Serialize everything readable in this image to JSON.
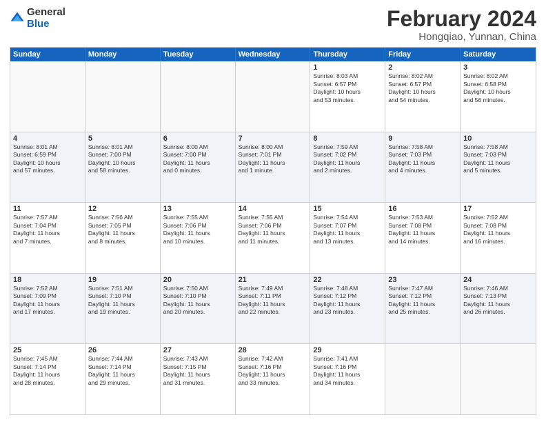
{
  "logo": {
    "general": "General",
    "blue": "Blue"
  },
  "title": "February 2024",
  "subtitle": "Hongqiao, Yunnan, China",
  "headers": [
    "Sunday",
    "Monday",
    "Tuesday",
    "Wednesday",
    "Thursday",
    "Friday",
    "Saturday"
  ],
  "weeks": [
    [
      {
        "day": "",
        "info": ""
      },
      {
        "day": "",
        "info": ""
      },
      {
        "day": "",
        "info": ""
      },
      {
        "day": "",
        "info": ""
      },
      {
        "day": "1",
        "info": "Sunrise: 8:03 AM\nSunset: 6:57 PM\nDaylight: 10 hours\nand 53 minutes."
      },
      {
        "day": "2",
        "info": "Sunrise: 8:02 AM\nSunset: 6:57 PM\nDaylight: 10 hours\nand 54 minutes."
      },
      {
        "day": "3",
        "info": "Sunrise: 8:02 AM\nSunset: 6:58 PM\nDaylight: 10 hours\nand 56 minutes."
      }
    ],
    [
      {
        "day": "4",
        "info": "Sunrise: 8:01 AM\nSunset: 6:59 PM\nDaylight: 10 hours\nand 57 minutes."
      },
      {
        "day": "5",
        "info": "Sunrise: 8:01 AM\nSunset: 7:00 PM\nDaylight: 10 hours\nand 58 minutes."
      },
      {
        "day": "6",
        "info": "Sunrise: 8:00 AM\nSunset: 7:00 PM\nDaylight: 11 hours\nand 0 minutes."
      },
      {
        "day": "7",
        "info": "Sunrise: 8:00 AM\nSunset: 7:01 PM\nDaylight: 11 hours\nand 1 minute."
      },
      {
        "day": "8",
        "info": "Sunrise: 7:59 AM\nSunset: 7:02 PM\nDaylight: 11 hours\nand 2 minutes."
      },
      {
        "day": "9",
        "info": "Sunrise: 7:58 AM\nSunset: 7:03 PM\nDaylight: 11 hours\nand 4 minutes."
      },
      {
        "day": "10",
        "info": "Sunrise: 7:58 AM\nSunset: 7:03 PM\nDaylight: 11 hours\nand 5 minutes."
      }
    ],
    [
      {
        "day": "11",
        "info": "Sunrise: 7:57 AM\nSunset: 7:04 PM\nDaylight: 11 hours\nand 7 minutes."
      },
      {
        "day": "12",
        "info": "Sunrise: 7:56 AM\nSunset: 7:05 PM\nDaylight: 11 hours\nand 8 minutes."
      },
      {
        "day": "13",
        "info": "Sunrise: 7:55 AM\nSunset: 7:06 PM\nDaylight: 11 hours\nand 10 minutes."
      },
      {
        "day": "14",
        "info": "Sunrise: 7:55 AM\nSunset: 7:06 PM\nDaylight: 11 hours\nand 11 minutes."
      },
      {
        "day": "15",
        "info": "Sunrise: 7:54 AM\nSunset: 7:07 PM\nDaylight: 11 hours\nand 13 minutes."
      },
      {
        "day": "16",
        "info": "Sunrise: 7:53 AM\nSunset: 7:08 PM\nDaylight: 11 hours\nand 14 minutes."
      },
      {
        "day": "17",
        "info": "Sunrise: 7:52 AM\nSunset: 7:08 PM\nDaylight: 11 hours\nand 16 minutes."
      }
    ],
    [
      {
        "day": "18",
        "info": "Sunrise: 7:52 AM\nSunset: 7:09 PM\nDaylight: 11 hours\nand 17 minutes."
      },
      {
        "day": "19",
        "info": "Sunrise: 7:51 AM\nSunset: 7:10 PM\nDaylight: 11 hours\nand 19 minutes."
      },
      {
        "day": "20",
        "info": "Sunrise: 7:50 AM\nSunset: 7:10 PM\nDaylight: 11 hours\nand 20 minutes."
      },
      {
        "day": "21",
        "info": "Sunrise: 7:49 AM\nSunset: 7:11 PM\nDaylight: 11 hours\nand 22 minutes."
      },
      {
        "day": "22",
        "info": "Sunrise: 7:48 AM\nSunset: 7:12 PM\nDaylight: 11 hours\nand 23 minutes."
      },
      {
        "day": "23",
        "info": "Sunrise: 7:47 AM\nSunset: 7:12 PM\nDaylight: 11 hours\nand 25 minutes."
      },
      {
        "day": "24",
        "info": "Sunrise: 7:46 AM\nSunset: 7:13 PM\nDaylight: 11 hours\nand 26 minutes."
      }
    ],
    [
      {
        "day": "25",
        "info": "Sunrise: 7:45 AM\nSunset: 7:14 PM\nDaylight: 11 hours\nand 28 minutes."
      },
      {
        "day": "26",
        "info": "Sunrise: 7:44 AM\nSunset: 7:14 PM\nDaylight: 11 hours\nand 29 minutes."
      },
      {
        "day": "27",
        "info": "Sunrise: 7:43 AM\nSunset: 7:15 PM\nDaylight: 11 hours\nand 31 minutes."
      },
      {
        "day": "28",
        "info": "Sunrise: 7:42 AM\nSunset: 7:16 PM\nDaylight: 11 hours\nand 33 minutes."
      },
      {
        "day": "29",
        "info": "Sunrise: 7:41 AM\nSunset: 7:16 PM\nDaylight: 11 hours\nand 34 minutes."
      },
      {
        "day": "",
        "info": ""
      },
      {
        "day": "",
        "info": ""
      }
    ]
  ]
}
